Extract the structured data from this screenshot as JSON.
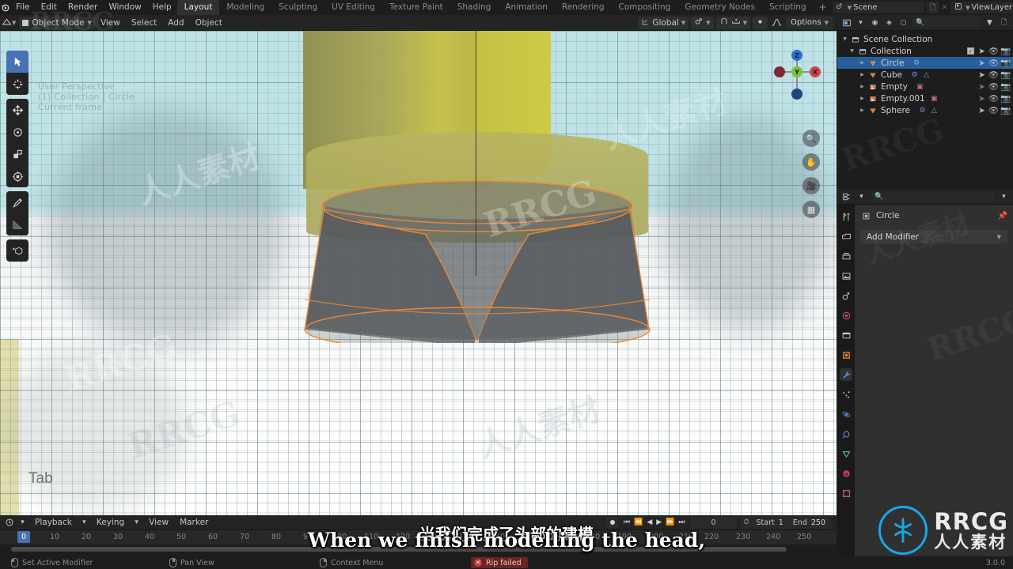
{
  "app": {
    "name": "Blender",
    "version": "3.0.0"
  },
  "topbar": {
    "menus": [
      "File",
      "Edit",
      "Render",
      "Window",
      "Help"
    ],
    "workspaces": [
      {
        "label": "Layout",
        "active": true
      },
      {
        "label": "Modeling",
        "active": false
      },
      {
        "label": "Sculpting",
        "active": false
      },
      {
        "label": "UV Editing",
        "active": false
      },
      {
        "label": "Texture Paint",
        "active": false
      },
      {
        "label": "Shading",
        "active": false
      },
      {
        "label": "Animation",
        "active": false
      },
      {
        "label": "Rendering",
        "active": false
      },
      {
        "label": "Compositing",
        "active": false
      },
      {
        "label": "Geometry Nodes",
        "active": false
      },
      {
        "label": "Scripting",
        "active": false
      }
    ],
    "add_workspace": "+",
    "scene_name": "Scene",
    "viewlayer_name": "ViewLayer",
    "scene_icon": "scene-icon",
    "viewlayer_icon": "viewlayer-icon",
    "new_scene_icon": "new-copy-icon",
    "new_viewlayer_icon": "new-copy-icon",
    "remove_icon": "x-icon"
  },
  "viewport_header": {
    "editor_type_icon": "editor-type-icon",
    "mode": "Object Mode",
    "menus": [
      "View",
      "Select",
      "Add",
      "Object"
    ],
    "transform_orientation": "Global",
    "pivot_icon": "pivot-point-icon",
    "snap_icon": "magnet-icon",
    "snap_to_icon": "snap-increment-icon",
    "proportional_icon": "proportional-edit-icon",
    "falloff_icon": "falloff-curve-icon",
    "overlay_icons": [
      "show-gizmo-icon",
      "show-overlays-icon",
      "xray-icon"
    ],
    "shading_modes": [
      "wireframe-shading",
      "solid-shading",
      "material-shading",
      "rendered-shading"
    ],
    "options_label": "Options"
  },
  "viewport": {
    "overlay_lines": [
      "User Perspective",
      "(1) Collection | Circle",
      "Current frame"
    ],
    "key_hint": "Tab",
    "gizmo_axes": [
      {
        "label": "Z",
        "color": "#2f6fd0",
        "pos": "top"
      },
      {
        "label": "Y",
        "color": "#7ec13b",
        "pos": "center"
      },
      {
        "label": "X",
        "color": "#d1424a",
        "pos": "right"
      }
    ],
    "nav_buttons": [
      "zoom-icon",
      "pan-hand-icon",
      "camera-view-icon",
      "toggle-ortho-grid-icon"
    ],
    "toolbar_tools": [
      {
        "name": "tweak-select-box-tool",
        "active": true
      },
      {
        "name": "cursor-tool",
        "active": false
      },
      {
        "name": "move-tool",
        "active": false
      },
      {
        "name": "rotate-tool",
        "active": false
      },
      {
        "name": "scale-tool",
        "active": false
      },
      {
        "name": "transform-tool",
        "active": false
      },
      {
        "name": "annotate-tool",
        "active": false
      },
      {
        "name": "measure-tool",
        "active": false
      },
      {
        "name": "add-cube-tool",
        "active": false
      }
    ]
  },
  "outliner": {
    "display_mode_icon": "outliner-display-mode-icon",
    "filter_icons": [
      "filter-funnel-icon",
      "new-collection-icon"
    ],
    "search_placeholder": "",
    "root": "Scene Collection",
    "collection": "Collection",
    "items": [
      {
        "name": "Circle",
        "type_icon": "mesh-icon",
        "selected": true,
        "extra_icons": [
          "modifier-icon"
        ]
      },
      {
        "name": "Cube",
        "type_icon": "mesh-icon",
        "selected": false,
        "extra_icons": [
          "modifier-icon",
          "mesh-data-icon"
        ]
      },
      {
        "name": "Empty",
        "type_icon": "image-empty-icon",
        "selected": false,
        "extra_icons": [
          "image-data-icon"
        ]
      },
      {
        "name": "Empty.001",
        "type_icon": "image-empty-icon",
        "selected": false,
        "extra_icons": [
          "image-data-icon"
        ]
      },
      {
        "name": "Sphere",
        "type_icon": "mesh-icon",
        "selected": false,
        "extra_icons": [
          "modifier-icon",
          "mesh-data-icon"
        ]
      }
    ],
    "row_toggles": [
      "select-arrow-icon",
      "eye-icon",
      "camera-icon"
    ]
  },
  "properties": {
    "editor_icon": "properties-editor-icon",
    "search_placeholder": "",
    "tabs": [
      {
        "name": "tool-tab",
        "active": false
      },
      {
        "name": "render-tab",
        "active": false
      },
      {
        "name": "output-tab",
        "active": false
      },
      {
        "name": "view-layer-tab",
        "active": false
      },
      {
        "name": "scene-tab",
        "active": false
      },
      {
        "name": "world-tab",
        "active": false
      },
      {
        "name": "collection-tab",
        "active": false
      },
      {
        "name": "object-tab",
        "active": false
      },
      {
        "name": "modifier-tab",
        "active": true
      },
      {
        "name": "particles-tab",
        "active": false
      },
      {
        "name": "physics-tab",
        "active": false
      },
      {
        "name": "constraints-tab",
        "active": false
      },
      {
        "name": "object-data-tab",
        "active": false
      },
      {
        "name": "material-tab",
        "active": false
      },
      {
        "name": "texture-tab",
        "active": false
      }
    ],
    "breadcrumb_object": "Circle",
    "pin_icon": "pin-icon",
    "add_modifier_label": "Add Modifier"
  },
  "timeline": {
    "editor_icon": "timeline-editor-icon",
    "menus": [
      "Playback",
      "Keying",
      "View",
      "Marker"
    ],
    "record_icon": "auto-keying-icon",
    "playback_controls": [
      "jump-start-icon",
      "prev-keyframe-icon",
      "play-reverse-icon",
      "play-icon",
      "next-keyframe-icon",
      "jump-end-icon"
    ],
    "current_frame_value": "0",
    "use_preview_range_icon": "stopwatch-icon",
    "start_label": "Start",
    "start_value": "1",
    "end_label": "End",
    "end_value": "250",
    "playhead_frame": "0",
    "ticks": [
      "10",
      "20",
      "30",
      "40",
      "50",
      "60",
      "70",
      "80",
      "90",
      "100",
      "110",
      "120",
      "130",
      "140",
      "150",
      "160",
      "170",
      "180",
      "190",
      "200",
      "210",
      "220",
      "230",
      "240",
      "250"
    ]
  },
  "statusbar": {
    "hints": [
      {
        "mouse": "left",
        "label": "Set Active Modifier"
      },
      {
        "mouse": "mid",
        "label": "Pan View"
      },
      {
        "mouse": "right",
        "label": "Context Menu"
      }
    ],
    "error": "Rip failed",
    "version": "3.0.0"
  },
  "subtitles": {
    "chinese": "当我们完成了头部的建模",
    "english": "When we finish modelling the head,"
  },
  "watermark": {
    "brand_latin": "RRCG",
    "brand_cn": "人人素材",
    "logo_glyph": "⚙"
  },
  "colors": {
    "accent_blue": "#4772b3",
    "selection_orange": "#e8883a",
    "outliner_select": "#2a5f9e",
    "logo_blue": "#17a8e8",
    "error_red": "#6b2323"
  }
}
